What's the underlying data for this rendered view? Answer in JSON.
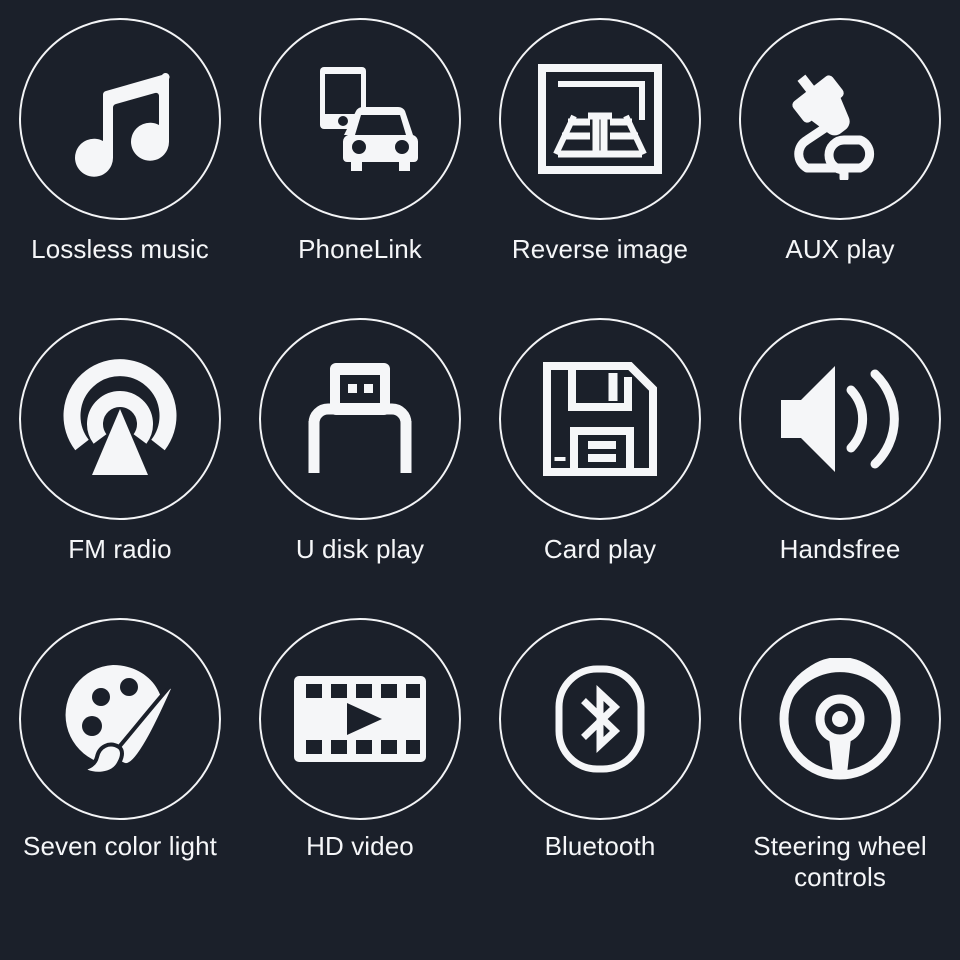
{
  "page": {
    "title": "Car stereo feature icon grid",
    "background_color": "#1b202a",
    "foreground_color": "#f5f6f8",
    "columns": 4,
    "rows": 3
  },
  "features": [
    {
      "label": "Lossless music",
      "icon": "music-note-icon",
      "row": 1,
      "col": 1
    },
    {
      "label": "PhoneLink",
      "icon": "phone-car-link-icon",
      "row": 1,
      "col": 2
    },
    {
      "label": "Reverse image",
      "icon": "rear-camera-icon",
      "row": 1,
      "col": 3
    },
    {
      "label": "AUX play",
      "icon": "aux-plug-icon",
      "row": 1,
      "col": 4
    },
    {
      "label": "FM radio",
      "icon": "radio-tower-icon",
      "row": 2,
      "col": 1
    },
    {
      "label": "U disk play",
      "icon": "usb-plug-icon",
      "row": 2,
      "col": 2
    },
    {
      "label": "Card play",
      "icon": "memory-card-icon",
      "row": 2,
      "col": 3
    },
    {
      "label": "Handsfree",
      "icon": "speaker-waves-icon",
      "row": 2,
      "col": 4
    },
    {
      "label": "Seven color light",
      "icon": "palette-brush-icon",
      "row": 3,
      "col": 1
    },
    {
      "label": "HD video",
      "icon": "film-play-icon",
      "row": 3,
      "col": 2
    },
    {
      "label": "Bluetooth",
      "icon": "bluetooth-icon",
      "row": 3,
      "col": 3
    },
    {
      "label": "Steering wheel\ncontrols",
      "icon": "steering-wheel-icon",
      "row": 3,
      "col": 4
    }
  ]
}
